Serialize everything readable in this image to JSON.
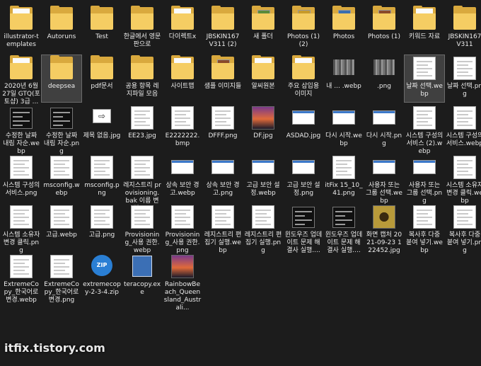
{
  "columns": 12,
  "colors": {
    "background": "#1c1c1c",
    "folder": "#f5cd63",
    "folder_back": "#d9a93e",
    "text": "#ececec"
  },
  "watermark": "itfix.tistory.com",
  "items": [
    {
      "label": "illustrator-templates",
      "icon": "folder-doc"
    },
    {
      "label": "Autoruns",
      "icon": "folder"
    },
    {
      "label": "Test",
      "icon": "folder"
    },
    {
      "label": "한글에서 영문판으로",
      "icon": "folder"
    },
    {
      "label": "다이렉트x",
      "icon": "folder-doc"
    },
    {
      "label": "JBSKIN167 V311 (2)",
      "icon": "folder"
    },
    {
      "label": "새 폴더",
      "icon": "folder-img"
    },
    {
      "label": "Photos (1) (2)",
      "icon": "folder-img"
    },
    {
      "label": "Photos",
      "icon": "folder-img"
    },
    {
      "label": "Photos (1)",
      "icon": "folder-img"
    },
    {
      "label": "키워드 자료",
      "icon": "folder-doc"
    },
    {
      "label": "JBSKIN167 V311",
      "icon": "folder"
    },
    {
      "label": "2020년 6월 27일 GTQ(포토샵) 3급 ...",
      "icon": "folder-doc"
    },
    {
      "label": "deepsea",
      "icon": "folder",
      "selected": true
    },
    {
      "label": "pdf문서",
      "icon": "folder"
    },
    {
      "label": "공용 항목 레지파일 모음",
      "icon": "folder"
    },
    {
      "label": "사이트맵",
      "icon": "folder-doc"
    },
    {
      "label": "샘플 이미지들",
      "icon": "folder-img"
    },
    {
      "label": "알씨원본",
      "icon": "folder-doc"
    },
    {
      "label": "주요 삽입용 이미지",
      "icon": "folder-doc"
    },
    {
      "label": "내 ... .webp",
      "icon": "pixel"
    },
    {
      "label": ".png",
      "icon": "pixel"
    },
    {
      "label": "날짜 선택.webp",
      "icon": "doc",
      "selected": true
    },
    {
      "label": "날짜 선택.png",
      "icon": "doc"
    },
    {
      "label": "수정한 날짜 내림 자순.webp",
      "icon": "dark"
    },
    {
      "label": "수정한 날짜 내림 자순.png",
      "icon": "dark"
    },
    {
      "label": "제목 없음.jpg",
      "icon": "arrow"
    },
    {
      "label": "EE23.jpg",
      "icon": "doc"
    },
    {
      "label": "E2222222.bmp",
      "icon": "doc"
    },
    {
      "label": "DFFF.png",
      "icon": "doc"
    },
    {
      "label": "DF.jpg",
      "icon": "photo"
    },
    {
      "label": "ASDAD.jpg",
      "icon": "dialog"
    },
    {
      "label": "다시 시작.webp",
      "icon": "dialog"
    },
    {
      "label": "다시 시작.png",
      "icon": "dialog"
    },
    {
      "label": "시스템 구성의 서비스 (2).webp",
      "icon": "doc"
    },
    {
      "label": "시스템 구성의 서비스.webp",
      "icon": "doc"
    },
    {
      "label": "시스템 구성의 서비스.png",
      "icon": "doc"
    },
    {
      "label": "msconfig.webp",
      "icon": "doc"
    },
    {
      "label": "msconfig.png",
      "icon": "doc"
    },
    {
      "label": "레지스트리 provisioning.bak 이름 변경.p...",
      "icon": "doc"
    },
    {
      "label": "상속 보안 경고.webp",
      "icon": "dialog"
    },
    {
      "label": "상속 보안 경고.png",
      "icon": "dialog"
    },
    {
      "label": "고급 보안 설정.webp",
      "icon": "dialog"
    },
    {
      "label": "고급 보안 설정.png",
      "icon": "dialog"
    },
    {
      "label": "itFix 15_10_41.png",
      "icon": "doc"
    },
    {
      "label": "사용자 또는 그룹 선택.webp",
      "icon": "dialog"
    },
    {
      "label": "사용자 또는 그룹 선택.png",
      "icon": "dialog"
    },
    {
      "label": "시스템 소유자 변경 클릭.webp",
      "icon": "doc"
    },
    {
      "label": "시스템 소유자 변경 클릭.png",
      "icon": "doc"
    },
    {
      "label": "고급.webp",
      "icon": "doc"
    },
    {
      "label": "고급.png",
      "icon": "doc"
    },
    {
      "label": "Provisioning_사용 권한.webp",
      "icon": "doc"
    },
    {
      "label": "Provisioning_사용 권한.png",
      "icon": "doc"
    },
    {
      "label": "레지스트리 편집기 실행.webp",
      "icon": "doc"
    },
    {
      "label": "레지스트리 편집기 실행.png",
      "icon": "doc"
    },
    {
      "label": "윈도우즈 업데이트 문제 해결사 실행....",
      "icon": "dark"
    },
    {
      "label": "윈도우즈 업데이트 문제 해결사 실행....",
      "icon": "dark"
    },
    {
      "label": "화면 캡처 2021-09-23 122452.jpg",
      "icon": "photo2"
    },
    {
      "label": "복사후 다중 붙여 넣기.webp",
      "icon": "doc"
    },
    {
      "label": "복사후 다중 붙여 넣기.png",
      "icon": "doc"
    },
    {
      "label": "ExtremeCopy_한국어로 변경.webp",
      "icon": "doc"
    },
    {
      "label": "ExtremeCopy_한국어로 변경.png",
      "icon": "doc"
    },
    {
      "label": "extremecopy-2-3-4.zip",
      "icon": "zip",
      "icon_text": "ZIP"
    },
    {
      "label": "teracopy.exe",
      "icon": "installer"
    },
    {
      "label": "RainbowBeach_Queensland_Australi...",
      "icon": "photo"
    }
  ]
}
